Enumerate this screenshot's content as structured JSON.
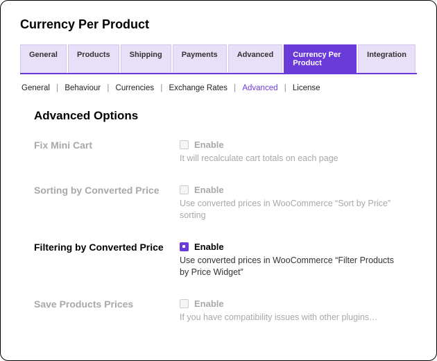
{
  "page_title": "Currency Per Product",
  "tabs": [
    {
      "label": "General"
    },
    {
      "label": "Products"
    },
    {
      "label": "Shipping"
    },
    {
      "label": "Payments"
    },
    {
      "label": "Advanced"
    },
    {
      "label": "Currency Per Product"
    },
    {
      "label": "Integration"
    }
  ],
  "subnav": {
    "items": [
      "General",
      "Behaviour",
      "Currencies",
      "Exchange Rates",
      "Advanced",
      "License"
    ],
    "active": "Advanced"
  },
  "section_title": "Advanced Options",
  "options": [
    {
      "label": "Fix Mini Cart",
      "enable_text": "Enable",
      "desc": "It will recalculate cart totals on each page",
      "checked": false,
      "enabled": false
    },
    {
      "label": "Sorting by Converted Price",
      "enable_text": "Enable",
      "desc": "Use converted prices in WooCommerce “Sort by Price” sorting",
      "checked": false,
      "enabled": false
    },
    {
      "label": "Filtering by Converted Price",
      "enable_text": "Enable",
      "desc": "Use converted prices in WooCommerce “Filter Products by Price Widget”",
      "checked": true,
      "enabled": true
    },
    {
      "label": "Save Products Prices",
      "enable_text": "Enable",
      "desc": "If you have compatibility issues with other plugins…",
      "checked": false,
      "enabled": false
    }
  ]
}
